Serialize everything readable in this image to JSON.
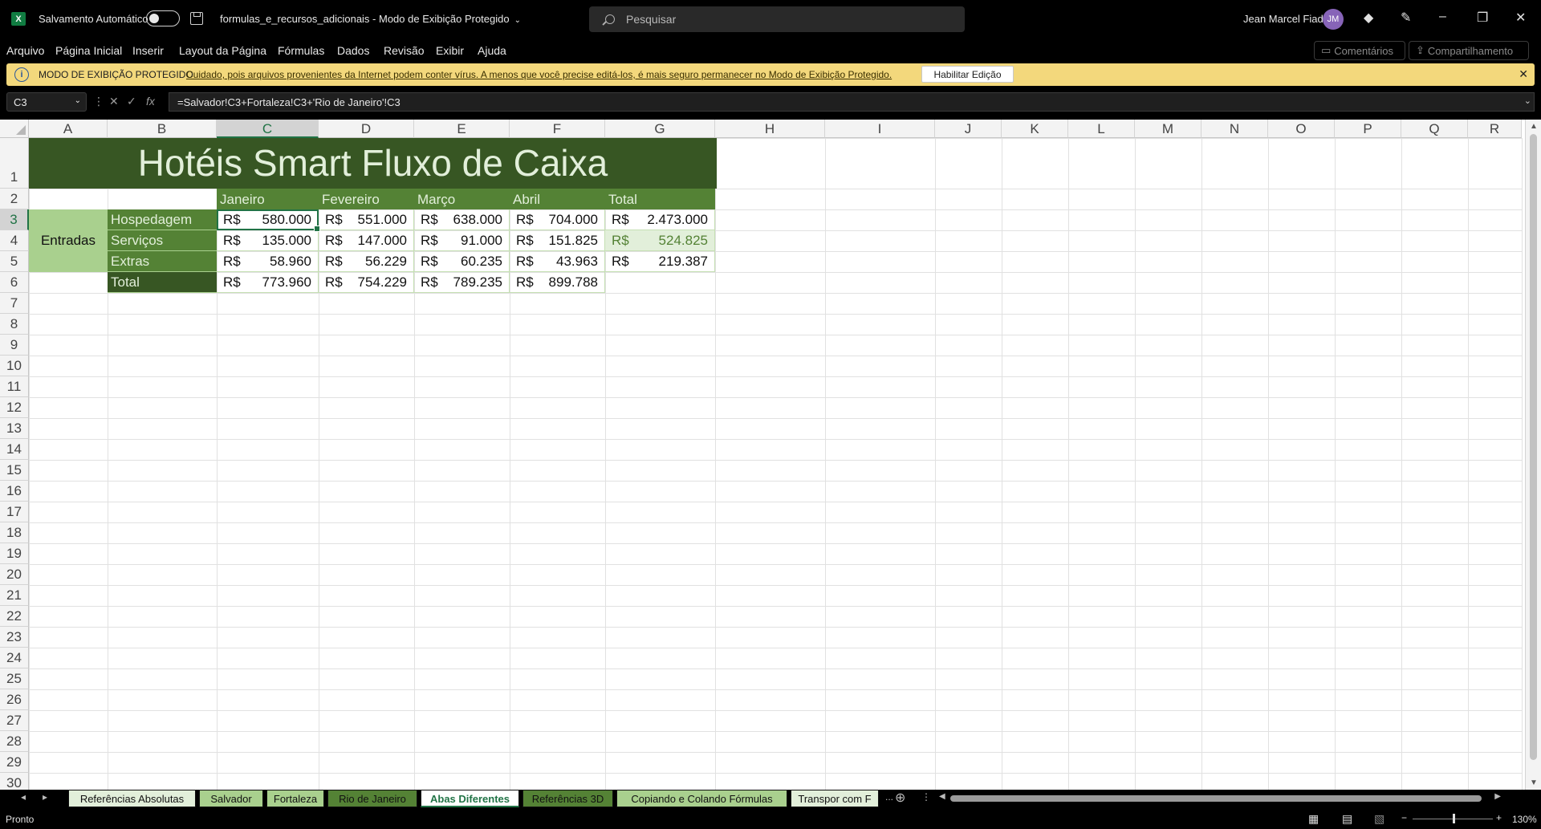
{
  "titlebar": {
    "app_icon": "excel-icon",
    "autosave_label": "Salvamento Automático",
    "filename": "formulas_e_recursos_adicionais",
    "mode": "Modo de Exibição Protegido",
    "search_placeholder": "Pesquisar",
    "user_name": "Jean Marcel Fiad",
    "user_initials": "JM"
  },
  "menu": [
    "Arquivo",
    "Página Inicial",
    "Inserir",
    "Layout da Página",
    "Fórmulas",
    "Dados",
    "Revisão",
    "Exibir",
    "Ajuda"
  ],
  "actions": {
    "comments": "Comentários",
    "share": "Compartilhamento"
  },
  "protected_bar": {
    "title": "MODO DE EXIBIÇÃO PROTEGIDO",
    "message": "Cuidado, pois arquivos provenientes da Internet podem conter vírus. A menos que você precise editá-los, é mais seguro permanecer no Modo de  Exibição Protegido.",
    "button": "Habilitar Edição"
  },
  "formula_bar": {
    "name_box": "C3",
    "fx": "fx",
    "formula": "=Salvador!C3+Fortaleza!C3+'Rio de Janeiro'!C3"
  },
  "columns": [
    "A",
    "B",
    "C",
    "D",
    "E",
    "F",
    "G",
    "H",
    "I",
    "J",
    "K",
    "L",
    "M",
    "N",
    "O",
    "P",
    "Q",
    "R"
  ],
  "rows": [
    "1",
    "2",
    "3",
    "4",
    "5",
    "6",
    "7",
    "8",
    "9",
    "10",
    "11",
    "12",
    "13",
    "14",
    "15",
    "16",
    "17",
    "18",
    "19",
    "20",
    "21",
    "22",
    "23",
    "24",
    "25",
    "26",
    "27",
    "28",
    "29",
    "30"
  ],
  "sheet": {
    "title": "Hotéis Smart Fluxo de Caixa",
    "months": [
      "Janeiro",
      "Fevereiro",
      "Março",
      "Abril",
      "Total"
    ],
    "group": "Entradas",
    "currency": "R$",
    "lines": [
      {
        "label": "Hospedagem",
        "values": [
          "580.000",
          "551.000",
          "638.000",
          "704.000",
          "2.473.000"
        ]
      },
      {
        "label": "Serviços",
        "values": [
          "135.000",
          "147.000",
          "91.000",
          "151.825",
          "524.825"
        ]
      },
      {
        "label": "Extras",
        "values": [
          "58.960",
          "56.229",
          "60.235",
          "43.963",
          "219.387"
        ]
      }
    ],
    "total": {
      "label": "Total",
      "values": [
        "773.960",
        "754.229",
        "789.235",
        "899.788"
      ]
    }
  },
  "tabs": [
    "Referências Absolutas",
    "Salvador",
    "Fortaleza",
    "Rio de Janeiro",
    "Abas Diferentes",
    "Referências 3D",
    "Copiando e Colando Fórmulas",
    "Transpor com F",
    "..."
  ],
  "tab_colors": [
    "#e2efda",
    "#a9d08e",
    "#a9d08e",
    "#548235",
    "#ffffff",
    "#548235",
    "#a9d08e",
    "#e2efda"
  ],
  "active_tab": "Abas Diferentes",
  "status": {
    "ready": "Pronto",
    "zoom": "130%"
  }
}
